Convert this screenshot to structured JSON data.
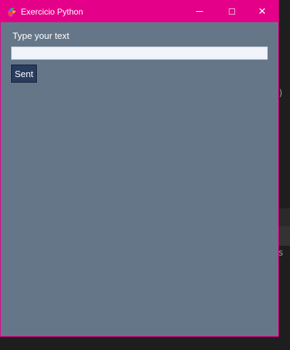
{
  "window": {
    "title": "Exercicio Python",
    "controls": {
      "minimize": "minimize",
      "maximize": "maximize",
      "close": "✕"
    }
  },
  "form": {
    "prompt_label": "Type your text",
    "input_value": "",
    "button_label": "Sent"
  },
  "background_editor": {
    "line_1": "))",
    "line_2": "ts"
  },
  "colors": {
    "titlebar": "#e5008a",
    "window_body": "#667689",
    "button": "#273c5e",
    "input": "#f1f3fa"
  }
}
